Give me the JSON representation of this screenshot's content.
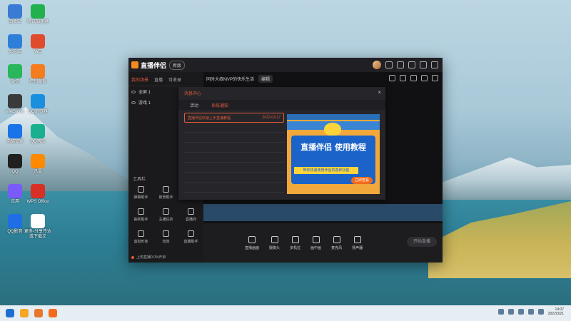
{
  "desktop": {
    "icons": [
      {
        "label": "回收站",
        "color": "#3a7bd5"
      },
      {
        "label": "腾讯加速器",
        "color": "#22b14c"
      },
      {
        "label": "此电脑",
        "color": "#2f7fd8"
      },
      {
        "label": "WE",
        "color": "#e04b2d"
      },
      {
        "label": "微信",
        "color": "#2ab65a"
      },
      {
        "label": "控制面板",
        "color": "#f57c1f"
      },
      {
        "label": "WeGame",
        "color": "#3a3a3a"
      },
      {
        "label": "QQ浏览器",
        "color": "#1a8fe0"
      },
      {
        "label": "电脑管家",
        "color": "#1a73e8"
      },
      {
        "label": "QQ音乐",
        "color": "#19b08f"
      },
      {
        "label": "QQ",
        "color": "#202020"
      },
      {
        "label": "迅雷",
        "color": "#ff8a00"
      },
      {
        "label": "应用",
        "color": "#7a5af8"
      },
      {
        "label": "WPS Office",
        "color": "#d93025"
      },
      {
        "label": "QQ影音",
        "color": "#1f6ee6"
      },
      {
        "label": "更多-分享传达或下载文",
        "color": "#ffffff"
      }
    ]
  },
  "app": {
    "brand": "直播伴侣",
    "badge": "新版",
    "tabs": [
      "我的场景",
      "直播",
      "可收录"
    ],
    "scenes": [
      "全屏 1",
      "游戏 1"
    ],
    "second_bar": {
      "title": "同时大叔MVP的快乐生活",
      "pill": "编辑"
    },
    "tools_title": "工具栏",
    "tools": [
      "弹幕助手",
      "房管助手",
      "",
      "抽奖助手",
      "主播任务",
      "直播间",
      "虚拟形象",
      "音效",
      "直播助手",
      "",
      "",
      ""
    ],
    "bottom_note": "上热直播0.0%开启",
    "bottom_controls": [
      "直播画面",
      "摄像头",
      "多机位",
      "画中画",
      "麦克风",
      "扬声器"
    ],
    "start_live": "开始直播"
  },
  "modal": {
    "title": "消息中心",
    "close": "×",
    "tabs": [
      "活动",
      "系统通知"
    ],
    "rows": [
      {
        "title": "直播伴侣快速上手直播教程",
        "date": "2022-03-17"
      },
      {
        "title": "",
        "date": ""
      },
      {
        "title": "",
        "date": ""
      },
      {
        "title": "",
        "date": ""
      },
      {
        "title": "",
        "date": ""
      },
      {
        "title": "",
        "date": ""
      },
      {
        "title": "",
        "date": ""
      },
      {
        "title": "",
        "date": ""
      }
    ],
    "banner": {
      "heading": "直播伴侣 使用教程",
      "sub": "带你快速使用伴侣的各种功能",
      "button": "立即查看"
    }
  },
  "taskbar": {
    "time": "14:07",
    "date": "2022/3/21"
  }
}
